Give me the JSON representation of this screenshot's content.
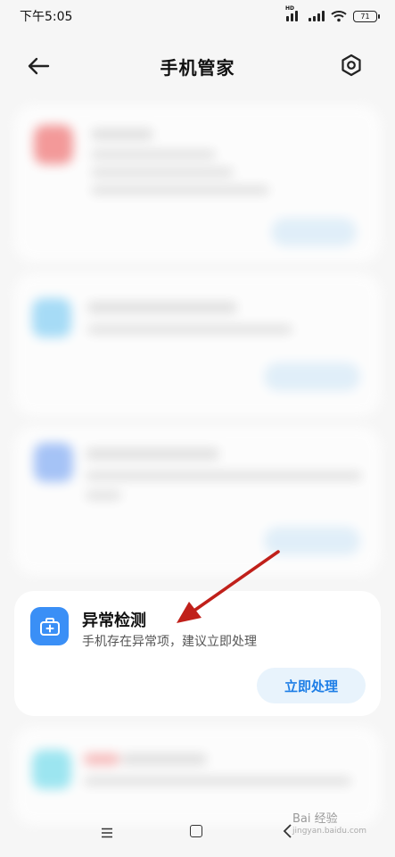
{
  "status_bar": {
    "time": "下午5:05",
    "battery": "71",
    "signal_badge": "HD"
  },
  "header": {
    "title": "手机管家",
    "back_icon": "arrow-left-icon",
    "settings_icon": "gear-icon"
  },
  "anomaly_card": {
    "icon": "first-aid-case-icon",
    "title": "异常检测",
    "description": "手机存在异常项，建议立即处理",
    "action_label": "立即处理"
  },
  "navbar": {
    "menu_icon": "menu-icon",
    "home_icon": "home-icon",
    "back_icon": "back-icon"
  },
  "watermark": {
    "brand": "Bai 经验",
    "url": "jingyan.baidu.com"
  },
  "colors": {
    "accent": "#3a8ff6",
    "button_bg": "#e8f3fc",
    "button_text": "#1e7ee6",
    "annotation_arrow": "#c0201a"
  }
}
